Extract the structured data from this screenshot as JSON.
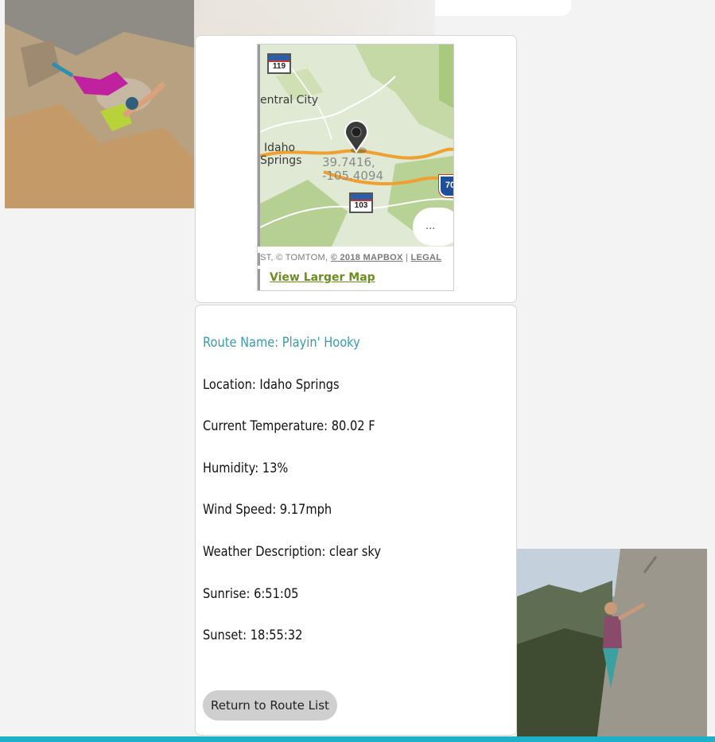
{
  "map": {
    "labels": {
      "central_city": "entral City",
      "idaho": "Idaho",
      "springs": "Springs"
    },
    "coords": {
      "lat": "39.7416,",
      "lon": "-105.4094"
    },
    "shields": {
      "hwy_119": "119",
      "hwy_103": "103",
      "i_70": "70"
    },
    "more_label": "...",
    "attribution_prefix": "ST, © TOMTOM, ",
    "attribution_mapbox": "© 2018 MAPBOX",
    "attribution_sep": " | ",
    "attribution_legal": "LEGAL",
    "view_larger_label": "View Larger Map"
  },
  "route": {
    "name_line": "Route Name: Playin' Hooky",
    "location_line": "Location: Idaho Springs",
    "temperature_line": "Current Temperature: 80.02 F",
    "humidity_line": "Humidity: 13%",
    "wind_line": "Wind Speed: 9.17mph",
    "description_line": "Weather Description: clear sky",
    "sunrise_line": "Sunrise: 6:51:05",
    "sunset_line": "Sunset: 18:55:32",
    "return_label": "Return to Route List"
  },
  "colors": {
    "accent_bar": "#1fb0c9",
    "route_title": "#3a9bb0",
    "map_link": "#6b8e1e"
  }
}
